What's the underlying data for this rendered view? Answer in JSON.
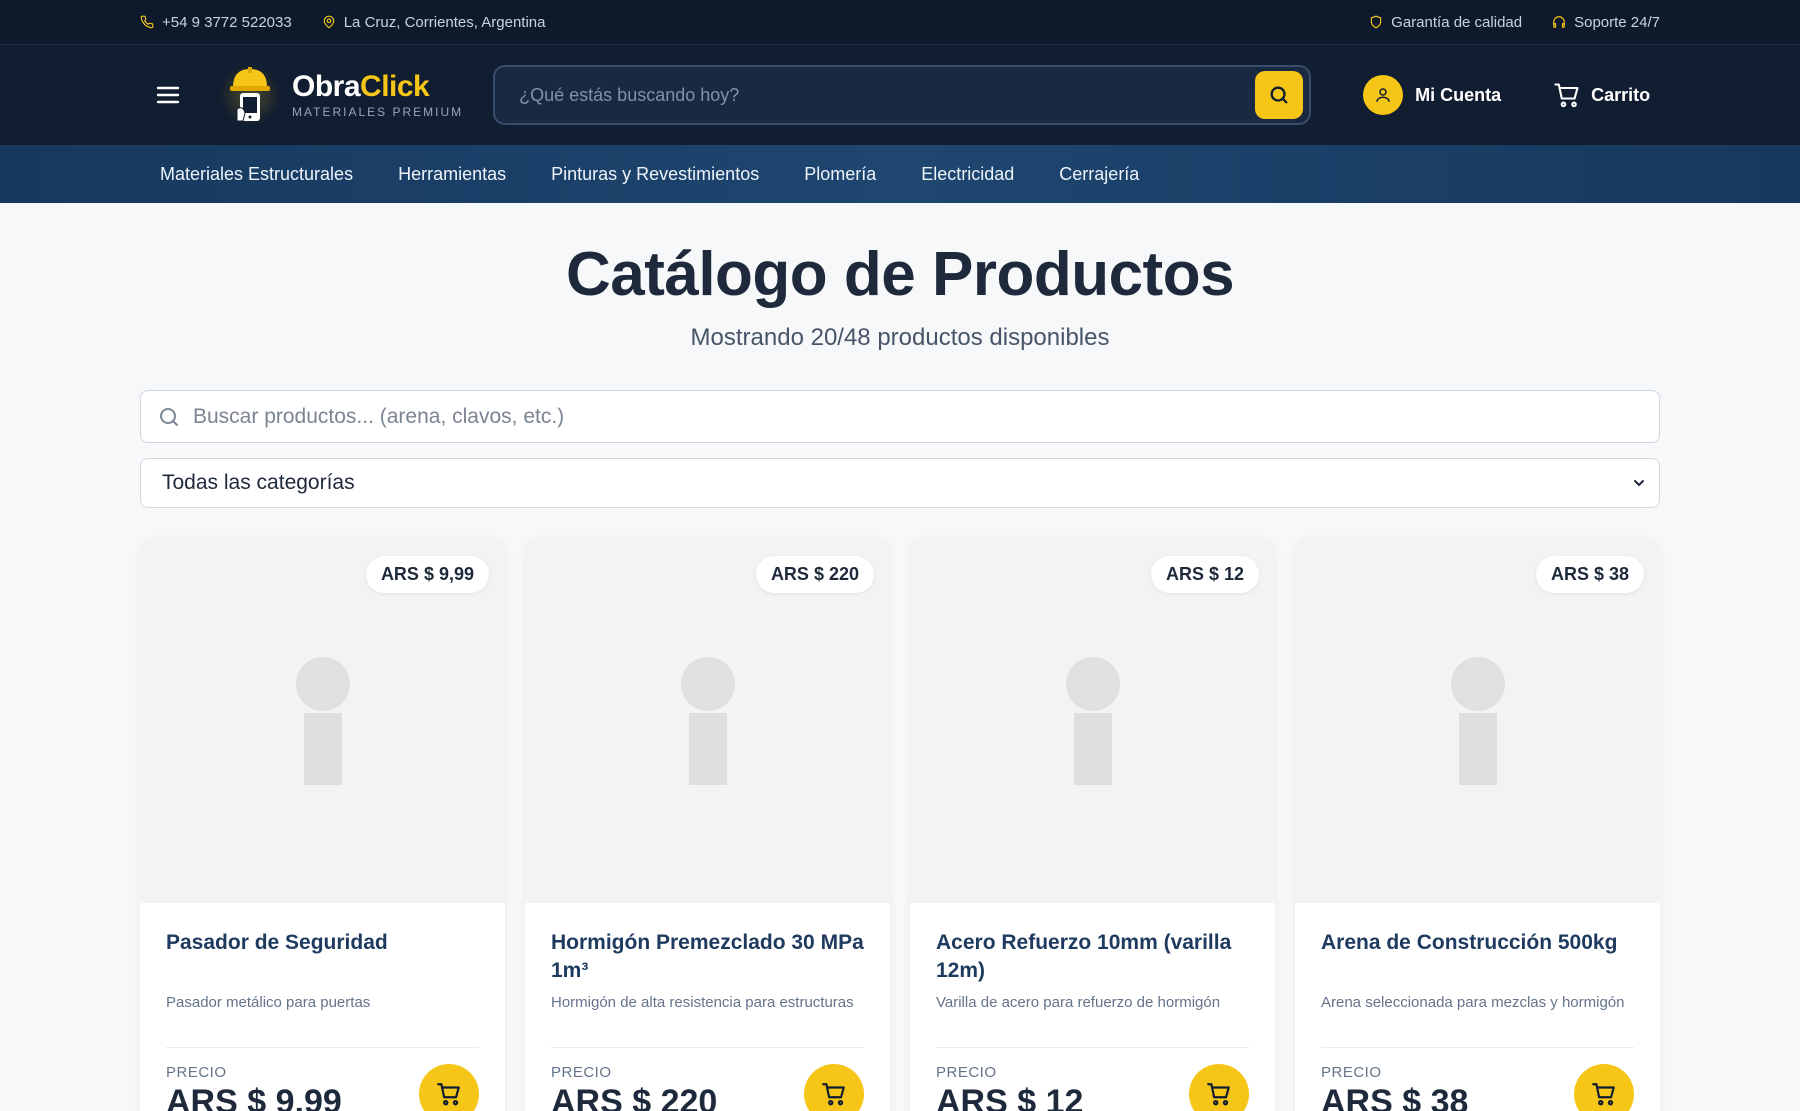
{
  "topbar": {
    "phone": "+54 9 3772 522033",
    "location": "La Cruz, Corrientes, Argentina",
    "quality": "Garantía de calidad",
    "support": "Soporte 24/7"
  },
  "header": {
    "brand_part1": "Obra",
    "brand_part2": "Click",
    "brand_tagline": "MATERIALES PREMIUM",
    "search_placeholder": "¿Qué estás buscando hoy?",
    "account_label": "Mi Cuenta",
    "cart_label": "Carrito"
  },
  "categories_nav": [
    "Materiales Estructurales",
    "Herramientas",
    "Pinturas y Revestimientos",
    "Plomería",
    "Electricidad",
    "Cerrajería"
  ],
  "catalog": {
    "title": "Catálogo de Productos",
    "subtitle": "Mostrando 20/48 productos disponibles",
    "search_placeholder": "Buscar productos... (arena, clavos, etc.)",
    "category_select": "Todas las categorías",
    "price_label": "PRECIO"
  },
  "products": [
    {
      "badge": "ARS $ 9,99",
      "name": "Pasador de Seguridad",
      "desc": "Pasador metálico para puertas",
      "price": "ARS $ 9,99"
    },
    {
      "badge": "ARS $ 220",
      "name": "Hormigón Premezclado 30 MPa 1m³",
      "desc": "Hormigón de alta resistencia para estructuras",
      "price": "ARS $ 220"
    },
    {
      "badge": "ARS $ 12",
      "name": "Acero Refuerzo 10mm (varilla 12m)",
      "desc": "Varilla de acero para refuerzo de hormigón",
      "price": "ARS $ 12"
    },
    {
      "badge": "ARS $ 38",
      "name": "Arena de Construcción 500kg",
      "desc": "Arena seleccionada para mezclas y hormigón",
      "price": "ARS $ 38"
    }
  ],
  "colors": {
    "accent": "#f5c518",
    "header_bg": "#111d30",
    "nav_bg": "#1e4670"
  }
}
